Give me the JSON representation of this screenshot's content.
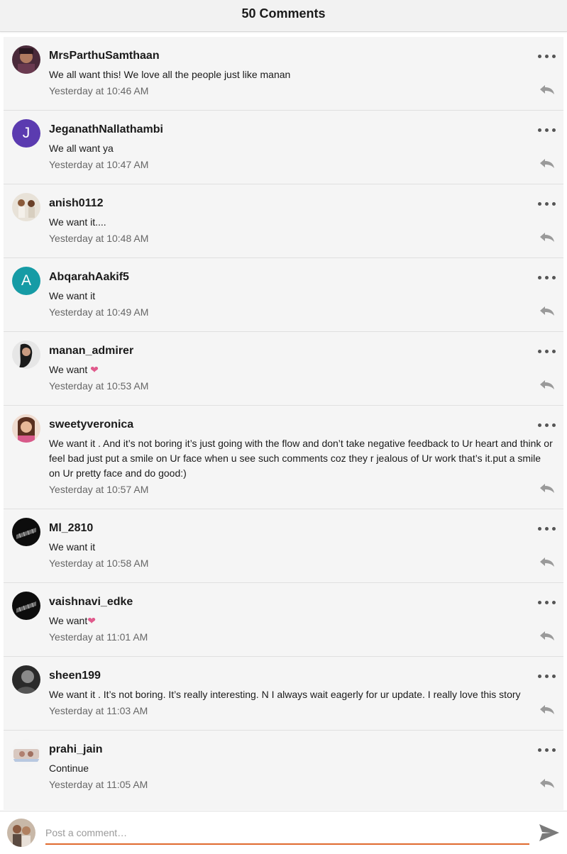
{
  "header": {
    "title": "50 Comments"
  },
  "colors": {
    "avatar_j": "#5b3bb0",
    "avatar_a": "#169ba5",
    "heart": "#e05a8c",
    "input_underline": "#e06a2e"
  },
  "comments": [
    {
      "user": "MrsParthuSamthaan",
      "text": "We all want this! We love all the people just like manan",
      "time": "Yesterday at 10:46 AM"
    },
    {
      "user": "JeganathNallathambi",
      "avatar_letter": "J",
      "text": "We all want ya",
      "time": "Yesterday at 10:47 AM"
    },
    {
      "user": "anish0112",
      "text": "We want it....",
      "time": "Yesterday at 10:48 AM"
    },
    {
      "user": "AbqarahAakif5",
      "avatar_letter": "A",
      "text": "We want it",
      "time": "Yesterday at 10:49 AM"
    },
    {
      "user": "manan_admirer",
      "text": "We want ",
      "heart": "❤",
      "time": "Yesterday at 10:53 AM"
    },
    {
      "user": "sweetyveronica",
      "text": "We want it . And it’s not boring it’s just going with the flow and don’t take negative feedback to Ur heart and think or feel bad just put a smile on Ur face when u see such comments coz they r jealous of Ur work that’s it.put a smile on Ur pretty face and do good:)",
      "time": "Yesterday at 10:57 AM"
    },
    {
      "user": "Ml_2810",
      "text": "We want it",
      "time": "Yesterday at 10:58 AM"
    },
    {
      "user": "vaishnavi_edke",
      "text": "We want",
      "heart": "❤",
      "time": "Yesterday at 11:01 AM"
    },
    {
      "user": "sheen199",
      "text": "We want it . It’s not boring. It’s really interesting. N I always wait eagerly for ur update. I really love this story",
      "time": "Yesterday at 11:03 AM"
    },
    {
      "user": "prahi_jain",
      "text": "Continue",
      "time": "Yesterday at 11:05 AM"
    }
  ],
  "composer": {
    "placeholder": "Post a comment…"
  }
}
